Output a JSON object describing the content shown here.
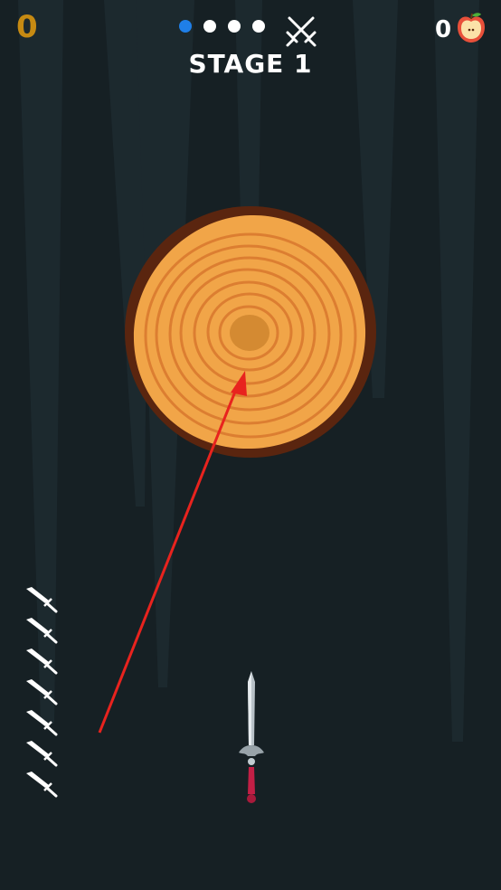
{
  "hud": {
    "score": "0",
    "stage_label": "STAGE 1",
    "apple_count": "0",
    "stage_progress": {
      "current": 1,
      "total": 4
    },
    "boss_icon": "crossed-swords-icon",
    "apple_icon": "apple-icon"
  },
  "game": {
    "target": "wood-log",
    "knives_remaining": 7,
    "current_knife": "sword-knife"
  },
  "colors": {
    "background": "#162024",
    "score": "#c68a12",
    "active_dot": "#1f7fe8",
    "aim_arrow": "#e8231e",
    "wood": "#f1a548",
    "bark": "#5a250f"
  }
}
